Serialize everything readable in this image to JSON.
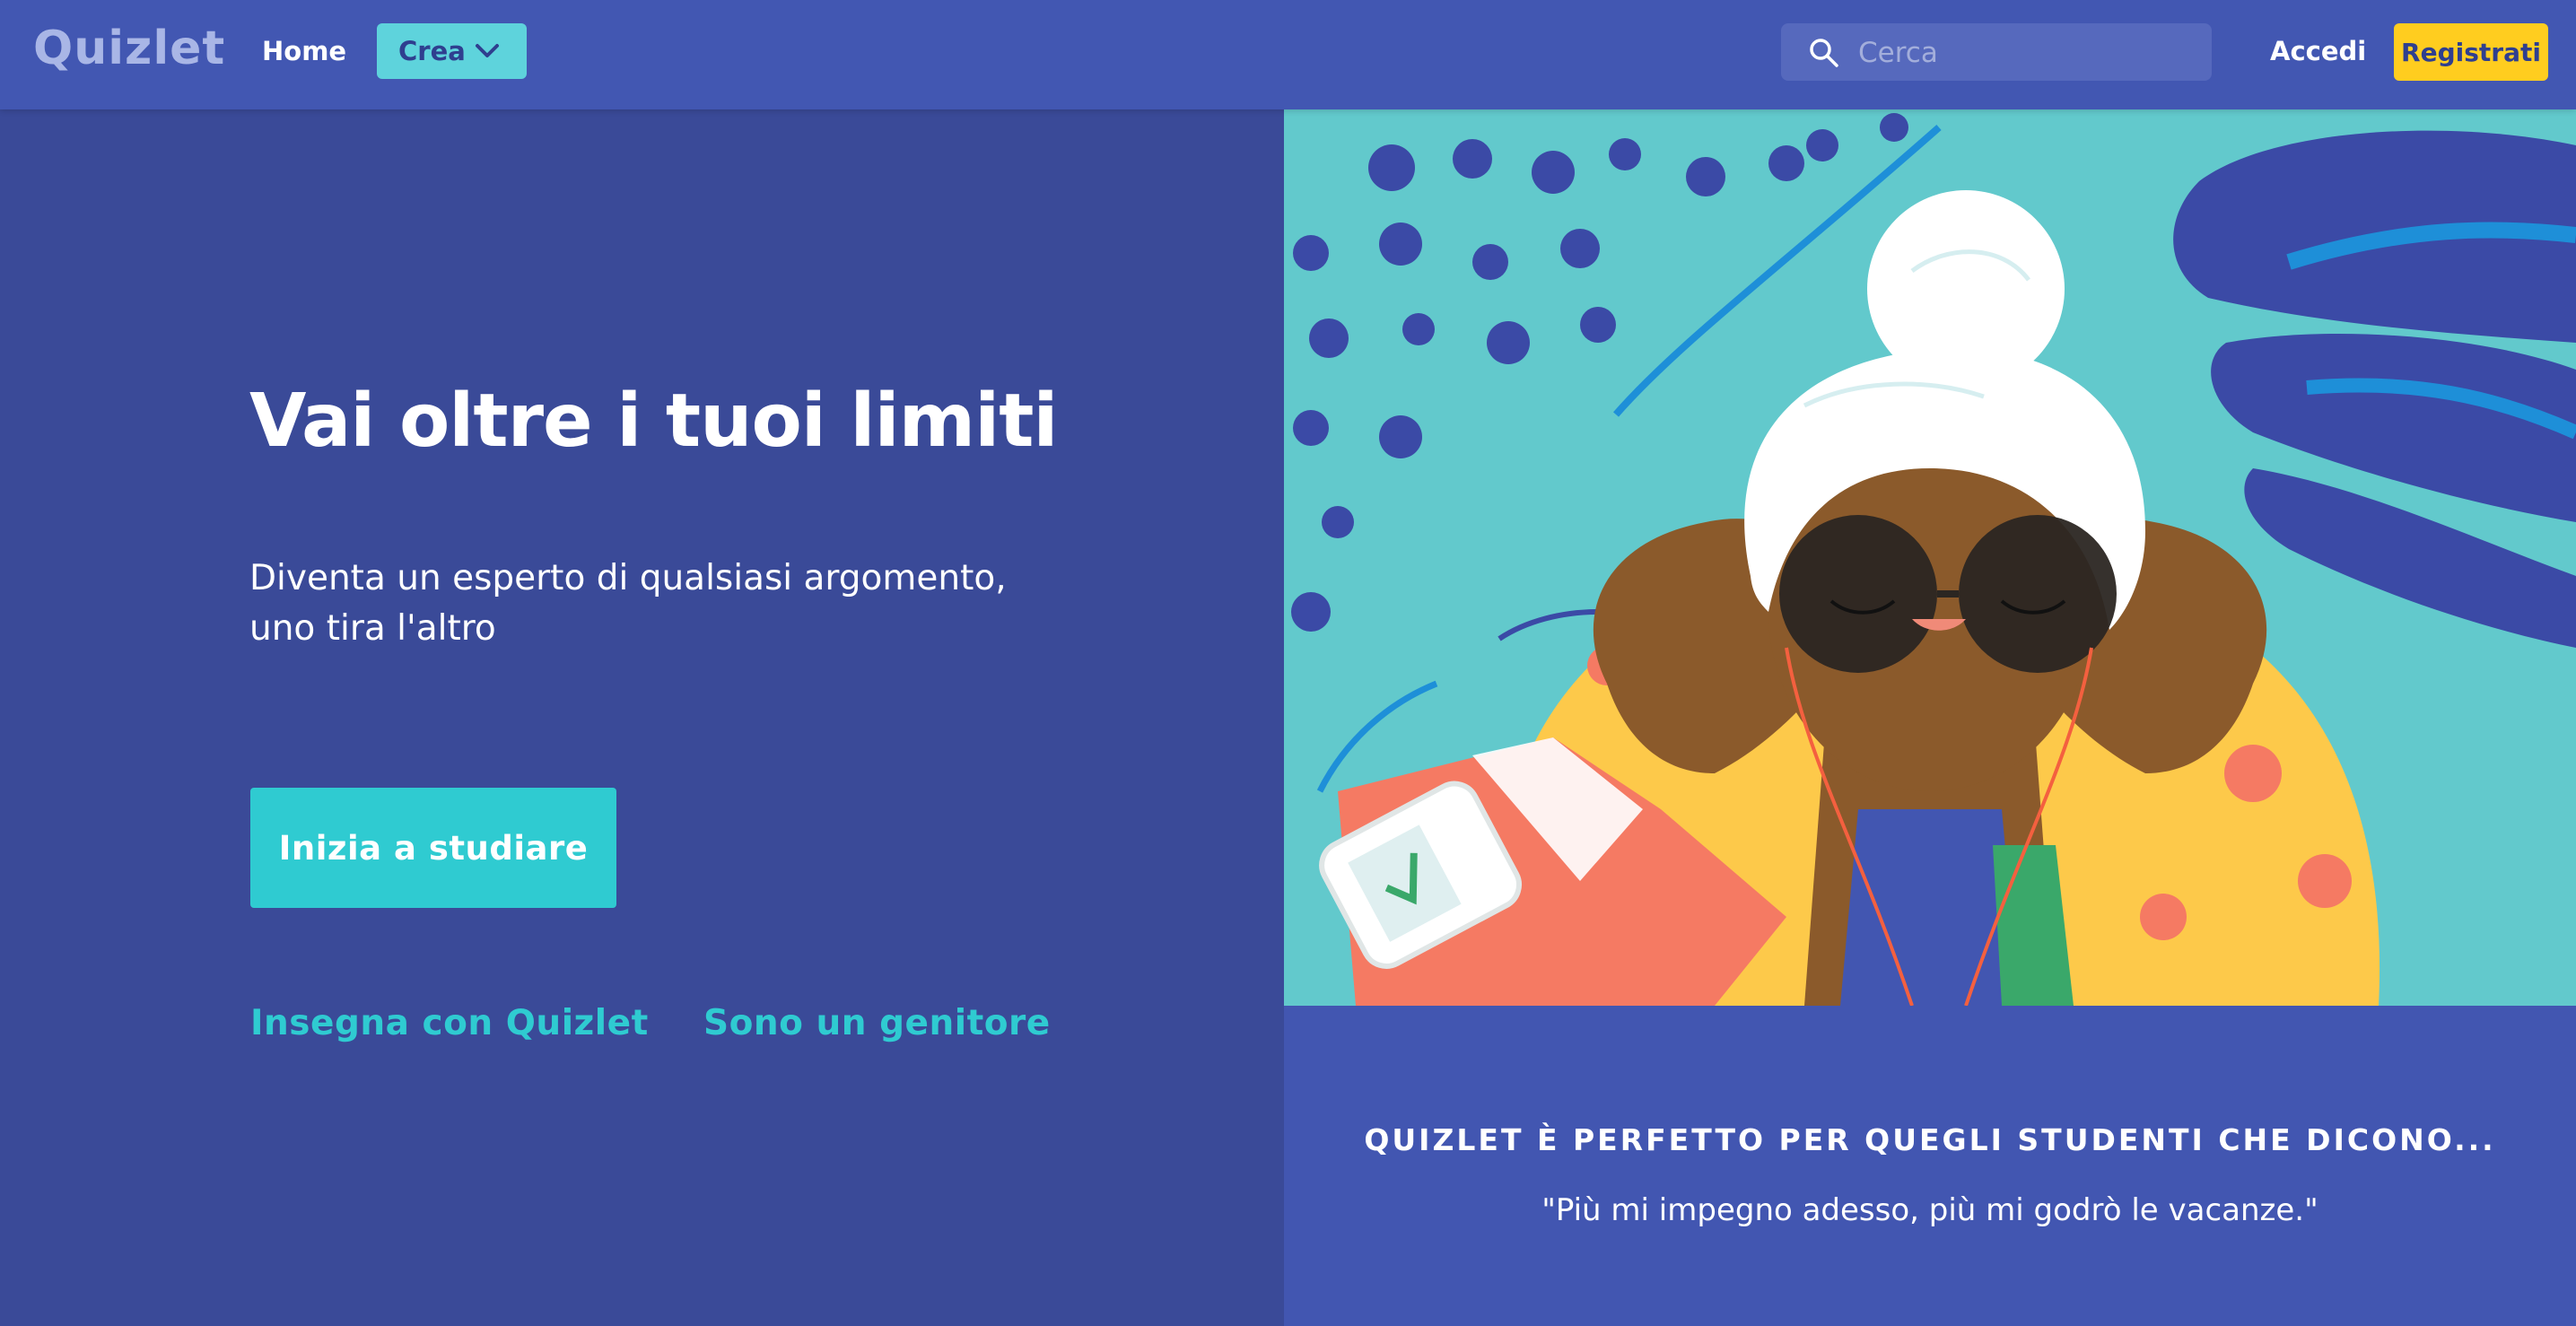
{
  "header": {
    "logo": "Quizlet",
    "home_label": "Home",
    "create_label": "Crea",
    "search_placeholder": "Cerca",
    "login_label": "Accedi",
    "signup_label": "Registrati"
  },
  "hero": {
    "headline": "Vai oltre i tuoi limiti",
    "subhead_line1": "Diventa un esperto di qualsiasi argomento,",
    "subhead_line2": "uno tira l'altro",
    "cta_label": "Inizia a studiare",
    "teach_link": "Insegna con Quizlet",
    "parent_link": "Sono un genitore"
  },
  "quote": {
    "title": "QUIZLET È PERFETTO PER QUEGLI STUDENTI CHE DICONO...",
    "text": "\"Più mi impegno adesso, più mi godrò le vacanze.\""
  },
  "colors": {
    "header_bg": "#4257b2",
    "hero_bg": "#3a4a98",
    "accent_teal": "#2fcbd1",
    "signup_yellow": "#ffcd1f",
    "illustration_bg": "#62c9cc"
  },
  "icons": {
    "search": "search-icon",
    "create_dropdown": "chevron-down-icon"
  }
}
